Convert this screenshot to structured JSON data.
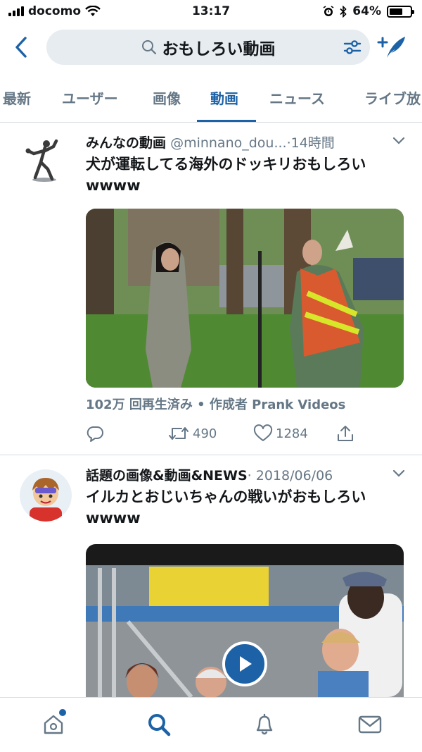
{
  "status_bar": {
    "carrier": "docomo",
    "time": "13:17",
    "battery": "64%",
    "battery_level": 0.64
  },
  "search": {
    "query": "おもしろい動画"
  },
  "tabs": [
    {
      "label": "最新"
    },
    {
      "label": "ユーザー"
    },
    {
      "label": "画像"
    },
    {
      "label": "動画",
      "active": true
    },
    {
      "label": "ニュース"
    },
    {
      "label": "ライブ放"
    }
  ],
  "tweets": [
    {
      "author": "みんなの動画",
      "handle": "@minnano_dou...",
      "time": "·14時間",
      "text": "犬が運転してる海外のドッキリおもしろいwwww",
      "video_info": "102万 回再生済み • 作成者 Prank Videos",
      "retweets": "490",
      "likes": "1284"
    },
    {
      "author": "話題の画像&動画&NEWS",
      "handle": "",
      "time": "· 2018/06/06",
      "text": "イルカとおじいちゃんの戦いがおもしろいwwww"
    }
  ],
  "colors": {
    "accent": "#1d62a6",
    "secondary_text": "#657786",
    "divider": "#d6dde3",
    "search_bg": "#e6ecf0"
  },
  "icons": {
    "back": "chevron-left-icon",
    "search": "search-icon",
    "filter": "sliders-icon",
    "compose": "compose-feather-icon",
    "caret": "chevron-down-icon",
    "reply": "reply-icon",
    "retweet": "retweet-icon",
    "like": "heart-icon",
    "share": "share-icon",
    "play": "play-icon",
    "nav_home": "home-icon",
    "nav_search": "search-icon",
    "nav_notifications": "bell-icon",
    "nav_messages": "mail-icon"
  }
}
